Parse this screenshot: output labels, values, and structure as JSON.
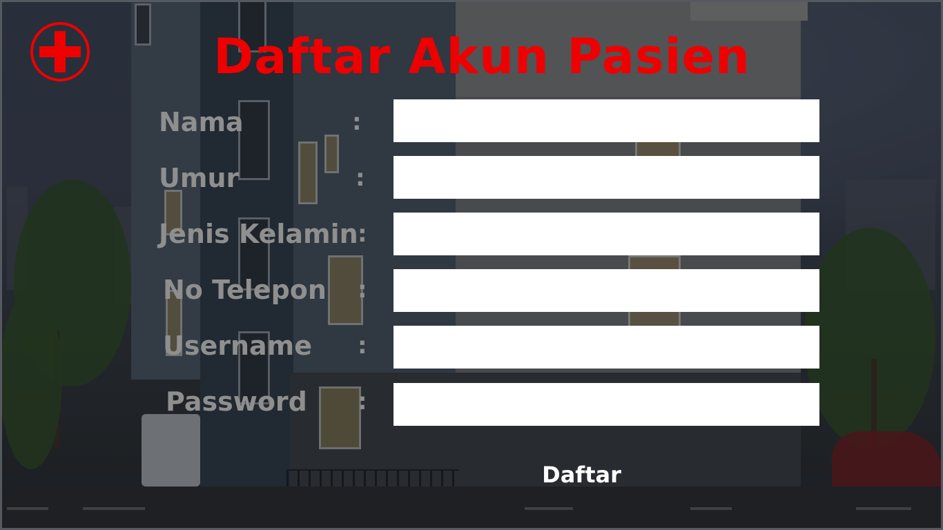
{
  "app": {
    "title": "Daftar Akun Pasien",
    "logo_icon": "red-cross-icon",
    "accent_color": "#ee0000",
    "label_color": "#8f8f8f"
  },
  "form": {
    "fields": [
      {
        "label": "Nama",
        "separator": ":",
        "value": "",
        "placeholder": ""
      },
      {
        "label": "Umur",
        "separator": ":",
        "value": "",
        "placeholder": ""
      },
      {
        "label": "Jenis Kelamin",
        "separator": ":",
        "value": "",
        "placeholder": ""
      },
      {
        "label": "No Telepon",
        "separator": ":",
        "value": "",
        "placeholder": ""
      },
      {
        "label": "Username",
        "separator": ":",
        "value": "",
        "placeholder": ""
      },
      {
        "label": "Password",
        "separator": ":",
        "value": "",
        "placeholder": ""
      }
    ],
    "submit_label": "Daftar"
  }
}
